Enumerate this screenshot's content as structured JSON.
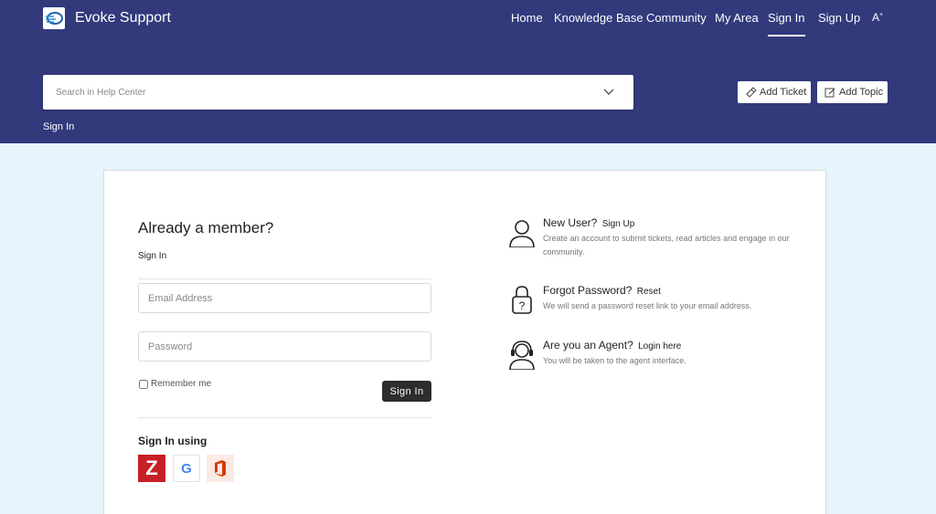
{
  "header": {
    "brand": "Evoke Support",
    "nav": [
      {
        "label": "Home"
      },
      {
        "label": "Knowledge Base"
      },
      {
        "label": "Community"
      },
      {
        "label": "My Area"
      },
      {
        "label": "Sign In",
        "active": true
      },
      {
        "label": "Sign Up"
      }
    ],
    "font_size_icon": "A",
    "search": {
      "placeholder": "Search in Help Center",
      "value": ""
    },
    "add_ticket_label": "Add Ticket",
    "add_topic_label": "Add Topic",
    "breadcrumb": "Sign In"
  },
  "login": {
    "title": "Already a member?",
    "subtitle": "Sign In",
    "email_placeholder": "Email Address",
    "password_placeholder": "Password",
    "remember_label": "Remember me",
    "signin_label": "Sign In",
    "using_label": "Sign In using",
    "providers": [
      {
        "name": "zoho",
        "icon": "zoho-icon",
        "letter": "Z",
        "color": "#c62026"
      },
      {
        "name": "google",
        "icon": "google-icon",
        "letter": "G",
        "color": "#4285f4"
      },
      {
        "name": "office365",
        "icon": "office-icon",
        "color": "#d83b01"
      }
    ]
  },
  "info": [
    {
      "heading": "New User?",
      "link": "Sign Up",
      "description": "Create an account to submit tickets, read articles and engage in our community.",
      "icon": "user-icon"
    },
    {
      "heading": "Forgot Password?",
      "link": "Reset",
      "description": "We will send a password reset link to your email address.",
      "icon": "lock-icon"
    },
    {
      "heading": "Are you an Agent?",
      "link": "Login here",
      "description": "You will be taken to the agent interface.",
      "icon": "headset-icon"
    }
  ],
  "colors": {
    "header_bg": "#323a7c",
    "page_bg": "#e6f4fb",
    "button_dark": "#2d2d2d"
  }
}
